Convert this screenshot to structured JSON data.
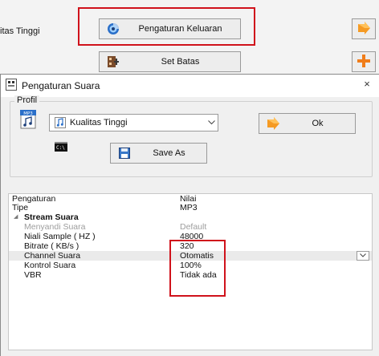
{
  "background": {
    "quality_label": "itas Tinggi",
    "output_settings_label": "Pengaturan Keluaran",
    "set_limit_label": "Set Batas"
  },
  "dialog": {
    "title": "Pengaturan Suara",
    "close_label": "×",
    "profile_group_label": "Profil",
    "profile_value": "Kualitas Tinggi",
    "ok_label": "Ok",
    "save_as_label": "Save As"
  },
  "table": {
    "headers": {
      "name": "Pengaturan",
      "value": "Nilai"
    },
    "rows": [
      {
        "name": "Tipe",
        "value": "MP3"
      },
      {
        "name": "Stream Suara",
        "value": ""
      },
      {
        "name": "Menyandi Suara",
        "value": "Default"
      },
      {
        "name": "Niali Sample ( HZ )",
        "value": "48000"
      },
      {
        "name": "Bitrate ( KB/s )",
        "value": "320"
      },
      {
        "name": "Channel Suara",
        "value": "Otomatis"
      },
      {
        "name": "Kontrol Suara",
        "value": "100%"
      },
      {
        "name": "VBR",
        "value": "Tidak ada"
      }
    ],
    "expand_glyph": "◢"
  },
  "colors": {
    "highlight": "#d0121b",
    "accent_orange": "#f59a23"
  }
}
